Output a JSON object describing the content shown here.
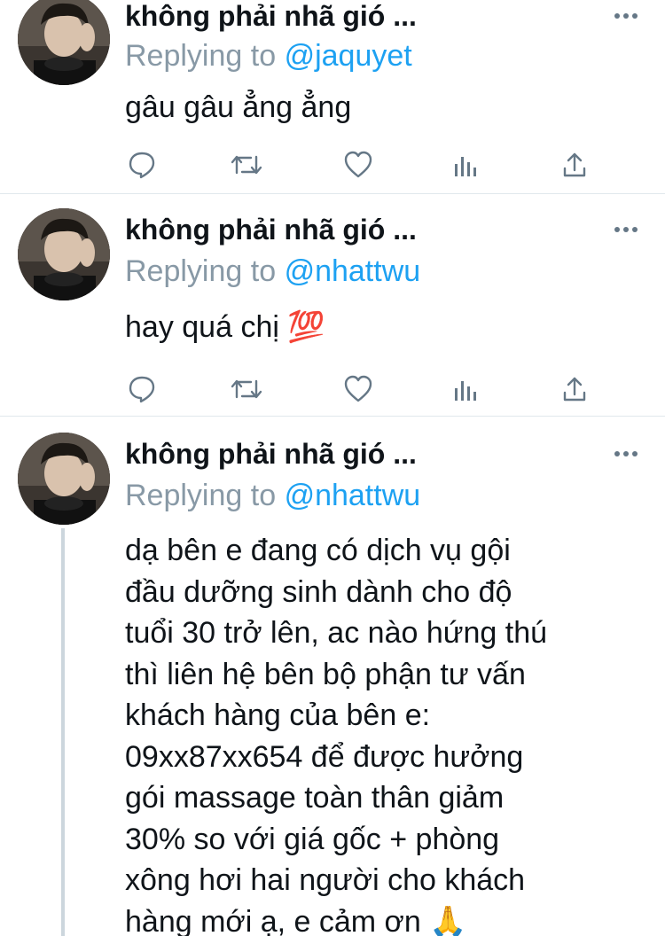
{
  "tweets": [
    {
      "display_name": "không phải nhã gió ...",
      "reply_prefix": "Replying to",
      "reply_handle": "@jaquyet",
      "text": "gâu gâu ẳng ẳng"
    },
    {
      "display_name": "không phải nhã gió ...",
      "reply_prefix": "Replying to",
      "reply_handle": "@nhattwu",
      "text": "hay quá chị 💯"
    },
    {
      "display_name": "không phải nhã gió ...",
      "reply_prefix": "Replying to",
      "reply_handle": "@nhattwu",
      "text": "dạ bên e đang có dịch vụ gội\nđầu dưỡng sinh dành cho độ\ntuổi 30 trở lên, ac nào hứng thú\nthì liên hệ bên bộ phận tư vấn\nkhách hàng của bên e:\n09xx87xx654 để được hưởng\ngói massage toàn thân giảm\n30% so với giá gốc + phòng\nxông hơi hai người cho khách\nhàng mới ạ, e cảm ơn 🙏"
    }
  ],
  "icons": {
    "more": "more-horizontal-icon",
    "reply": "reply-bubble-icon",
    "retweet": "retweet-icon",
    "like": "heart-icon",
    "stats": "bar-chart-icon",
    "share": "share-upload-icon"
  },
  "colors": {
    "text": "#0f1419",
    "secondary": "#8899a6",
    "link": "#1da1f2",
    "divider": "#e1e8ed",
    "icon": "#657786",
    "thread_line": "#ccd6dd"
  }
}
